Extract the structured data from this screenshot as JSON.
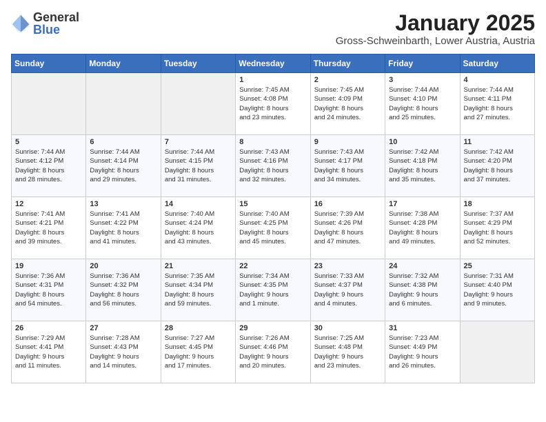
{
  "header": {
    "logo_general": "General",
    "logo_blue": "Blue",
    "title": "January 2025",
    "subtitle": "Gross-Schweinbarth, Lower Austria, Austria"
  },
  "weekdays": [
    "Sunday",
    "Monday",
    "Tuesday",
    "Wednesday",
    "Thursday",
    "Friday",
    "Saturday"
  ],
  "weeks": [
    [
      {
        "day": "",
        "info": ""
      },
      {
        "day": "",
        "info": ""
      },
      {
        "day": "",
        "info": ""
      },
      {
        "day": "1",
        "info": "Sunrise: 7:45 AM\nSunset: 4:08 PM\nDaylight: 8 hours\nand 23 minutes."
      },
      {
        "day": "2",
        "info": "Sunrise: 7:45 AM\nSunset: 4:09 PM\nDaylight: 8 hours\nand 24 minutes."
      },
      {
        "day": "3",
        "info": "Sunrise: 7:44 AM\nSunset: 4:10 PM\nDaylight: 8 hours\nand 25 minutes."
      },
      {
        "day": "4",
        "info": "Sunrise: 7:44 AM\nSunset: 4:11 PM\nDaylight: 8 hours\nand 27 minutes."
      }
    ],
    [
      {
        "day": "5",
        "info": "Sunrise: 7:44 AM\nSunset: 4:12 PM\nDaylight: 8 hours\nand 28 minutes."
      },
      {
        "day": "6",
        "info": "Sunrise: 7:44 AM\nSunset: 4:14 PM\nDaylight: 8 hours\nand 29 minutes."
      },
      {
        "day": "7",
        "info": "Sunrise: 7:44 AM\nSunset: 4:15 PM\nDaylight: 8 hours\nand 31 minutes."
      },
      {
        "day": "8",
        "info": "Sunrise: 7:43 AM\nSunset: 4:16 PM\nDaylight: 8 hours\nand 32 minutes."
      },
      {
        "day": "9",
        "info": "Sunrise: 7:43 AM\nSunset: 4:17 PM\nDaylight: 8 hours\nand 34 minutes."
      },
      {
        "day": "10",
        "info": "Sunrise: 7:42 AM\nSunset: 4:18 PM\nDaylight: 8 hours\nand 35 minutes."
      },
      {
        "day": "11",
        "info": "Sunrise: 7:42 AM\nSunset: 4:20 PM\nDaylight: 8 hours\nand 37 minutes."
      }
    ],
    [
      {
        "day": "12",
        "info": "Sunrise: 7:41 AM\nSunset: 4:21 PM\nDaylight: 8 hours\nand 39 minutes."
      },
      {
        "day": "13",
        "info": "Sunrise: 7:41 AM\nSunset: 4:22 PM\nDaylight: 8 hours\nand 41 minutes."
      },
      {
        "day": "14",
        "info": "Sunrise: 7:40 AM\nSunset: 4:24 PM\nDaylight: 8 hours\nand 43 minutes."
      },
      {
        "day": "15",
        "info": "Sunrise: 7:40 AM\nSunset: 4:25 PM\nDaylight: 8 hours\nand 45 minutes."
      },
      {
        "day": "16",
        "info": "Sunrise: 7:39 AM\nSunset: 4:26 PM\nDaylight: 8 hours\nand 47 minutes."
      },
      {
        "day": "17",
        "info": "Sunrise: 7:38 AM\nSunset: 4:28 PM\nDaylight: 8 hours\nand 49 minutes."
      },
      {
        "day": "18",
        "info": "Sunrise: 7:37 AM\nSunset: 4:29 PM\nDaylight: 8 hours\nand 52 minutes."
      }
    ],
    [
      {
        "day": "19",
        "info": "Sunrise: 7:36 AM\nSunset: 4:31 PM\nDaylight: 8 hours\nand 54 minutes."
      },
      {
        "day": "20",
        "info": "Sunrise: 7:36 AM\nSunset: 4:32 PM\nDaylight: 8 hours\nand 56 minutes."
      },
      {
        "day": "21",
        "info": "Sunrise: 7:35 AM\nSunset: 4:34 PM\nDaylight: 8 hours\nand 59 minutes."
      },
      {
        "day": "22",
        "info": "Sunrise: 7:34 AM\nSunset: 4:35 PM\nDaylight: 9 hours\nand 1 minute."
      },
      {
        "day": "23",
        "info": "Sunrise: 7:33 AM\nSunset: 4:37 PM\nDaylight: 9 hours\nand 4 minutes."
      },
      {
        "day": "24",
        "info": "Sunrise: 7:32 AM\nSunset: 4:38 PM\nDaylight: 9 hours\nand 6 minutes."
      },
      {
        "day": "25",
        "info": "Sunrise: 7:31 AM\nSunset: 4:40 PM\nDaylight: 9 hours\nand 9 minutes."
      }
    ],
    [
      {
        "day": "26",
        "info": "Sunrise: 7:29 AM\nSunset: 4:41 PM\nDaylight: 9 hours\nand 11 minutes."
      },
      {
        "day": "27",
        "info": "Sunrise: 7:28 AM\nSunset: 4:43 PM\nDaylight: 9 hours\nand 14 minutes."
      },
      {
        "day": "28",
        "info": "Sunrise: 7:27 AM\nSunset: 4:45 PM\nDaylight: 9 hours\nand 17 minutes."
      },
      {
        "day": "29",
        "info": "Sunrise: 7:26 AM\nSunset: 4:46 PM\nDaylight: 9 hours\nand 20 minutes."
      },
      {
        "day": "30",
        "info": "Sunrise: 7:25 AM\nSunset: 4:48 PM\nDaylight: 9 hours\nand 23 minutes."
      },
      {
        "day": "31",
        "info": "Sunrise: 7:23 AM\nSunset: 4:49 PM\nDaylight: 9 hours\nand 26 minutes."
      },
      {
        "day": "",
        "info": ""
      }
    ]
  ]
}
